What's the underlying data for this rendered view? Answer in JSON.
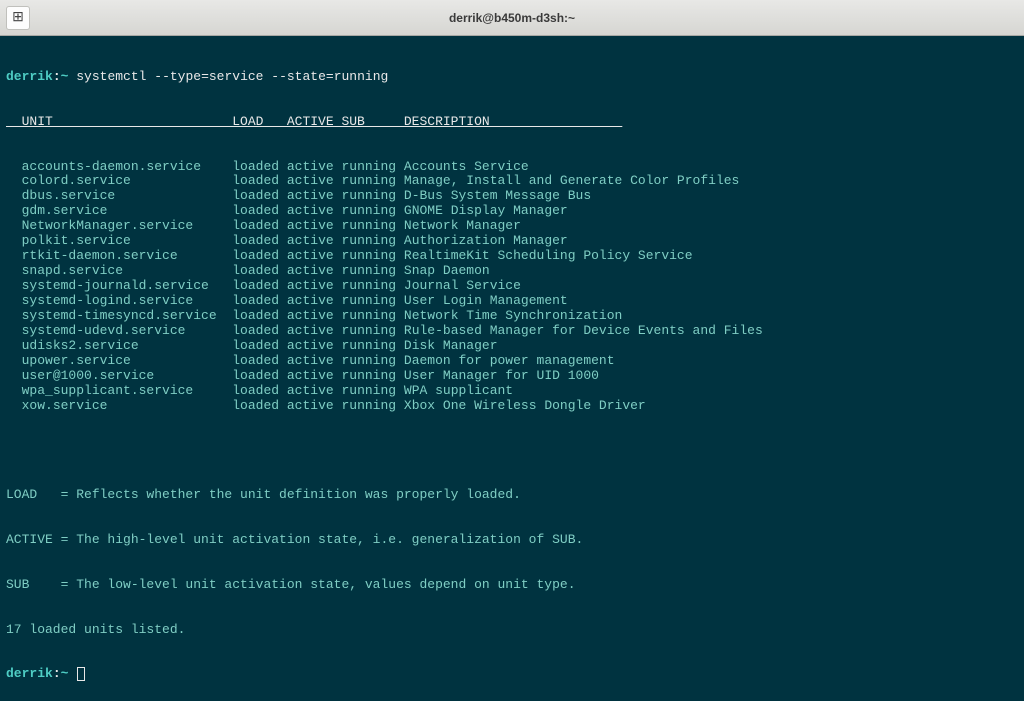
{
  "titlebar": {
    "title": "derrik@b450m-d3sh:~",
    "term_icon": "⊞"
  },
  "prompt": {
    "user": "derrik",
    "sep": ":",
    "path": "~",
    "dollar": " "
  },
  "command": "systemctl --type=service --state=running",
  "headers": {
    "unit": "UNIT",
    "load": "LOAD",
    "active": "ACTIVE",
    "sub": "SUB",
    "desc": "DESCRIPTION"
  },
  "rows": [
    {
      "unit": "accounts-daemon.service",
      "load": "loaded",
      "active": "active",
      "sub": "running",
      "desc": "Accounts Service"
    },
    {
      "unit": "colord.service",
      "load": "loaded",
      "active": "active",
      "sub": "running",
      "desc": "Manage, Install and Generate Color Profiles"
    },
    {
      "unit": "dbus.service",
      "load": "loaded",
      "active": "active",
      "sub": "running",
      "desc": "D-Bus System Message Bus"
    },
    {
      "unit": "gdm.service",
      "load": "loaded",
      "active": "active",
      "sub": "running",
      "desc": "GNOME Display Manager"
    },
    {
      "unit": "NetworkManager.service",
      "load": "loaded",
      "active": "active",
      "sub": "running",
      "desc": "Network Manager"
    },
    {
      "unit": "polkit.service",
      "load": "loaded",
      "active": "active",
      "sub": "running",
      "desc": "Authorization Manager"
    },
    {
      "unit": "rtkit-daemon.service",
      "load": "loaded",
      "active": "active",
      "sub": "running",
      "desc": "RealtimeKit Scheduling Policy Service"
    },
    {
      "unit": "snapd.service",
      "load": "loaded",
      "active": "active",
      "sub": "running",
      "desc": "Snap Daemon"
    },
    {
      "unit": "systemd-journald.service",
      "load": "loaded",
      "active": "active",
      "sub": "running",
      "desc": "Journal Service"
    },
    {
      "unit": "systemd-logind.service",
      "load": "loaded",
      "active": "active",
      "sub": "running",
      "desc": "User Login Management"
    },
    {
      "unit": "systemd-timesyncd.service",
      "load": "loaded",
      "active": "active",
      "sub": "running",
      "desc": "Network Time Synchronization"
    },
    {
      "unit": "systemd-udevd.service",
      "load": "loaded",
      "active": "active",
      "sub": "running",
      "desc": "Rule-based Manager for Device Events and Files"
    },
    {
      "unit": "udisks2.service",
      "load": "loaded",
      "active": "active",
      "sub": "running",
      "desc": "Disk Manager"
    },
    {
      "unit": "upower.service",
      "load": "loaded",
      "active": "active",
      "sub": "running",
      "desc": "Daemon for power management"
    },
    {
      "unit": "user@1000.service",
      "load": "loaded",
      "active": "active",
      "sub": "running",
      "desc": "User Manager for UID 1000"
    },
    {
      "unit": "wpa_supplicant.service",
      "load": "loaded",
      "active": "active",
      "sub": "running",
      "desc": "WPA supplicant"
    },
    {
      "unit": "xow.service",
      "load": "loaded",
      "active": "active",
      "sub": "running",
      "desc": "Xbox One Wireless Dongle Driver"
    }
  ],
  "legend": {
    "load": "LOAD   = Reflects whether the unit definition was properly loaded.",
    "active": "ACTIVE = The high-level unit activation state, i.e. generalization of SUB.",
    "sub": "SUB    = The low-level unit activation state, values depend on unit type.",
    "count": "17 loaded units listed."
  },
  "cols": {
    "unit": 27,
    "load": 7,
    "active": 7,
    "sub": 8
  }
}
